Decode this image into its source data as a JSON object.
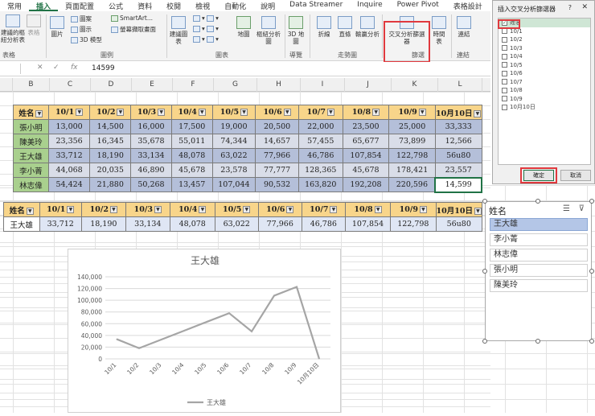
{
  "ribbon": {
    "tabs": [
      "常用",
      "插入",
      "頁面配置",
      "公式",
      "資料",
      "校閱",
      "檢視",
      "自動化",
      "說明",
      "Data Streamer",
      "Inquire",
      "Power Pivot",
      "表格設計"
    ],
    "groups": {
      "tables": "表格",
      "illustrations": "圖例",
      "charts": "圖表",
      "tours": "導覽",
      "sparklines": "走勢圖",
      "filters": "篩選",
      "links": "連結"
    },
    "buttons": {
      "recommended_pivot": "建議的樞紐分析表",
      "table": "表格",
      "pictures": "圖片",
      "shapes": "圖案",
      "icons": "圖示",
      "models_3d": "3D 模型",
      "smartart": "SmartArt...",
      "screenshot": "螢幕擷取畫面",
      "recommended_charts": "建議圖表",
      "maps": "地圖",
      "pivot_chart": "樞紐分析圖",
      "map_3d": "3D 地圖",
      "line": "折線",
      "column": "直條",
      "win_loss": "輸贏分析",
      "slicer": "交叉分析篩選器",
      "timeline": "時間表",
      "link": "連結"
    }
  },
  "formula_bar": {
    "fx": "fx",
    "value": "14599"
  },
  "columns": [
    "B",
    "C",
    "D",
    "E",
    "F",
    "G",
    "H",
    "I",
    "J",
    "K",
    "L"
  ],
  "table1": {
    "headers": [
      "姓名",
      "10/1",
      "10/2",
      "10/3",
      "10/4",
      "10/5",
      "10/6",
      "10/7",
      "10/8",
      "10/9",
      "10月10日"
    ],
    "rows": [
      [
        "張小明",
        "13,000",
        "14,500",
        "16,000",
        "17,500",
        "19,000",
        "20,500",
        "22,000",
        "23,500",
        "25,000",
        "33,333"
      ],
      [
        "陳美玲",
        "23,356",
        "16,345",
        "35,678",
        "55,011",
        "74,344",
        "14,657",
        "57,455",
        "65,677",
        "73,899",
        "12,566"
      ],
      [
        "王大雄",
        "33,712",
        "18,190",
        "33,134",
        "48,078",
        "63,022",
        "77,966",
        "46,786",
        "107,854",
        "122,798",
        "56u80"
      ],
      [
        "李小菁",
        "44,068",
        "20,035",
        "46,890",
        "45,678",
        "23,578",
        "77,777",
        "128,365",
        "45,678",
        "178,421",
        "23,557"
      ],
      [
        "林志偉",
        "54,424",
        "21,880",
        "50,268",
        "13,457",
        "107,044",
        "90,532",
        "163,820",
        "192,208",
        "220,596",
        "14,599"
      ]
    ]
  },
  "table2": {
    "headers": [
      "姓名",
      "10/1",
      "10/2",
      "10/3",
      "10/4",
      "10/5",
      "10/6",
      "10/7",
      "10/8",
      "10/9",
      "10月10日"
    ],
    "row": [
      "王大雄",
      "33,712",
      "18,190",
      "33,134",
      "48,078",
      "63,022",
      "77,966",
      "46,786",
      "107,854",
      "122,798",
      "56u80"
    ]
  },
  "chart_data": {
    "type": "line",
    "title": "王大雄",
    "categories": [
      "10/1",
      "10/2",
      "10/3",
      "10/4",
      "10/5",
      "10/6",
      "10/7",
      "10/8",
      "10/9",
      "10月10日"
    ],
    "series": [
      {
        "name": "王大雄",
        "values": [
          33712,
          18190,
          33134,
          48078,
          63022,
          77966,
          46786,
          107854,
          122798,
          0
        ]
      }
    ],
    "ylim": [
      0,
      140000
    ],
    "yticks": [
      "0",
      "20,000",
      "40,000",
      "60,000",
      "80,000",
      "100,000",
      "120,000",
      "140,000"
    ],
    "grid": true,
    "legend": "bottom",
    "color": "#a5a5a5"
  },
  "dialog": {
    "title": "插入交叉分析篩選器",
    "help": "?",
    "close": "✕",
    "items": [
      "姓名",
      "10/1",
      "10/2",
      "10/3",
      "10/4",
      "10/5",
      "10/6",
      "10/7",
      "10/8",
      "10/9",
      "10月10日"
    ],
    "checked": "姓名",
    "ok": "確定",
    "cancel": "取消"
  },
  "slicer": {
    "header": "姓名",
    "items": [
      "王大雄",
      "李小菁",
      "林志偉",
      "張小明",
      "陳美玲"
    ],
    "selected": "王大雄"
  }
}
